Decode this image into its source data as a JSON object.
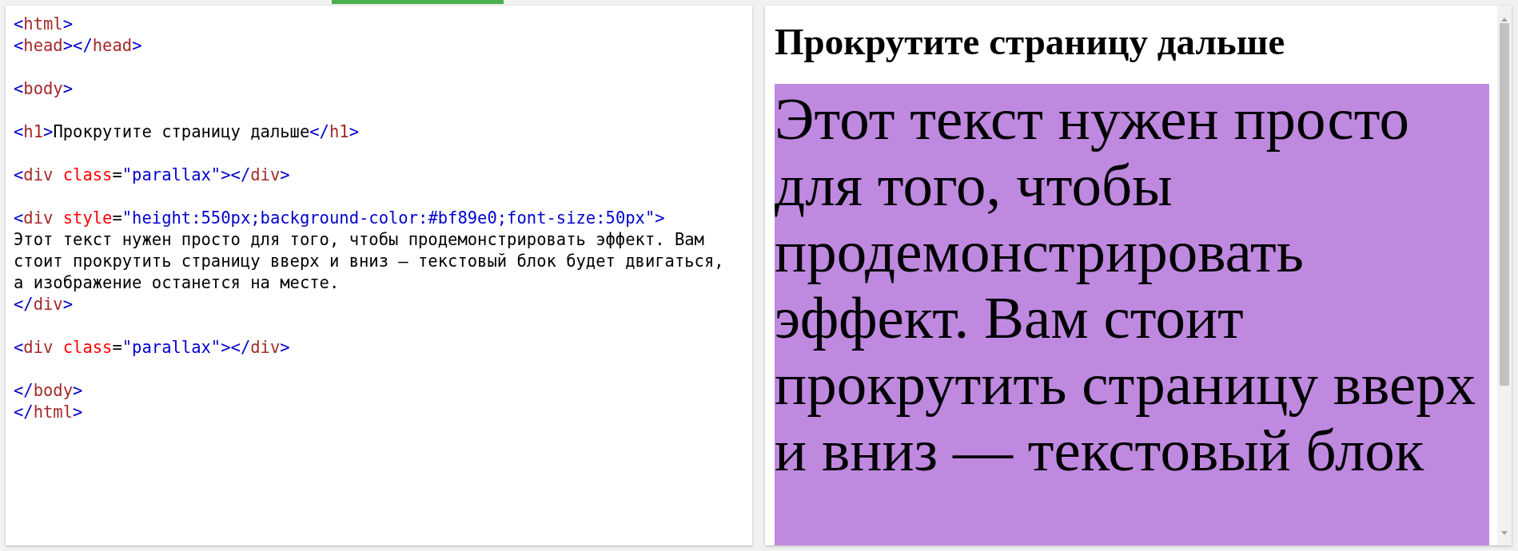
{
  "editor": {
    "code_blocks": [
      [
        [
          {
            "kind": "bracket",
            "text": "<"
          },
          {
            "kind": "tag",
            "text": "html"
          },
          {
            "kind": "bracket",
            "text": ">"
          }
        ],
        [
          {
            "kind": "bracket",
            "text": "<"
          },
          {
            "kind": "tag",
            "text": "head"
          },
          {
            "kind": "bracket",
            "text": "></"
          },
          {
            "kind": "tag",
            "text": "head"
          },
          {
            "kind": "bracket",
            "text": ">"
          }
        ]
      ],
      [
        [
          {
            "kind": "bracket",
            "text": "<"
          },
          {
            "kind": "tag",
            "text": "body"
          },
          {
            "kind": "bracket",
            "text": ">"
          }
        ]
      ],
      [
        [
          {
            "kind": "bracket",
            "text": "<"
          },
          {
            "kind": "tag",
            "text": "h1"
          },
          {
            "kind": "bracket",
            "text": ">"
          },
          {
            "kind": "text",
            "text": "Прокрутите страницу дальше"
          },
          {
            "kind": "bracket",
            "text": "</"
          },
          {
            "kind": "tag",
            "text": "h1"
          },
          {
            "kind": "bracket",
            "text": ">"
          }
        ]
      ],
      [
        [
          {
            "kind": "bracket",
            "text": "<"
          },
          {
            "kind": "tag",
            "text": "div"
          },
          {
            "kind": "attr",
            "text": " class"
          },
          {
            "kind": "text",
            "text": "="
          },
          {
            "kind": "value",
            "text": "\"parallax\""
          },
          {
            "kind": "bracket",
            "text": "></"
          },
          {
            "kind": "tag",
            "text": "div"
          },
          {
            "kind": "bracket",
            "text": ">"
          }
        ]
      ],
      [
        [
          {
            "kind": "bracket",
            "text": "<"
          },
          {
            "kind": "tag",
            "text": "div"
          },
          {
            "kind": "attr",
            "text": " style"
          },
          {
            "kind": "text",
            "text": "="
          },
          {
            "kind": "value",
            "text": "\"height:550px;background-color:#bf89e0;font-size:50px\""
          },
          {
            "kind": "bracket",
            "text": ">"
          }
        ],
        [
          {
            "kind": "text",
            "text": "Этот текст нужен просто для того, чтобы продемонстрировать эффект. Вам"
          }
        ],
        [
          {
            "kind": "text",
            "text": "стоит прокрутить страницу вверх и вниз — текстовый блок будет двигаться,"
          }
        ],
        [
          {
            "kind": "text",
            "text": "а изображение останется на месте."
          }
        ],
        [
          {
            "kind": "bracket",
            "text": "</"
          },
          {
            "kind": "tag",
            "text": "div"
          },
          {
            "kind": "bracket",
            "text": ">"
          }
        ]
      ],
      [
        [
          {
            "kind": "bracket",
            "text": "<"
          },
          {
            "kind": "tag",
            "text": "div"
          },
          {
            "kind": "attr",
            "text": " class"
          },
          {
            "kind": "text",
            "text": "="
          },
          {
            "kind": "value",
            "text": "\"parallax\""
          },
          {
            "kind": "bracket",
            "text": "></"
          },
          {
            "kind": "tag",
            "text": "div"
          },
          {
            "kind": "bracket",
            "text": ">"
          }
        ]
      ],
      [
        [
          {
            "kind": "bracket",
            "text": "</"
          },
          {
            "kind": "tag",
            "text": "body"
          },
          {
            "kind": "bracket",
            "text": ">"
          }
        ],
        [
          {
            "kind": "bracket",
            "text": "</"
          },
          {
            "kind": "tag",
            "text": "html"
          },
          {
            "kind": "bracket",
            "text": ">"
          }
        ]
      ]
    ]
  },
  "preview": {
    "heading": "Прокрутите страницу дальше",
    "block_text": "Этот текст нужен просто для того, чтобы продемонстрировать эффект. Вам стоит прокрутить страницу вверх и вниз — текстовый блок"
  }
}
